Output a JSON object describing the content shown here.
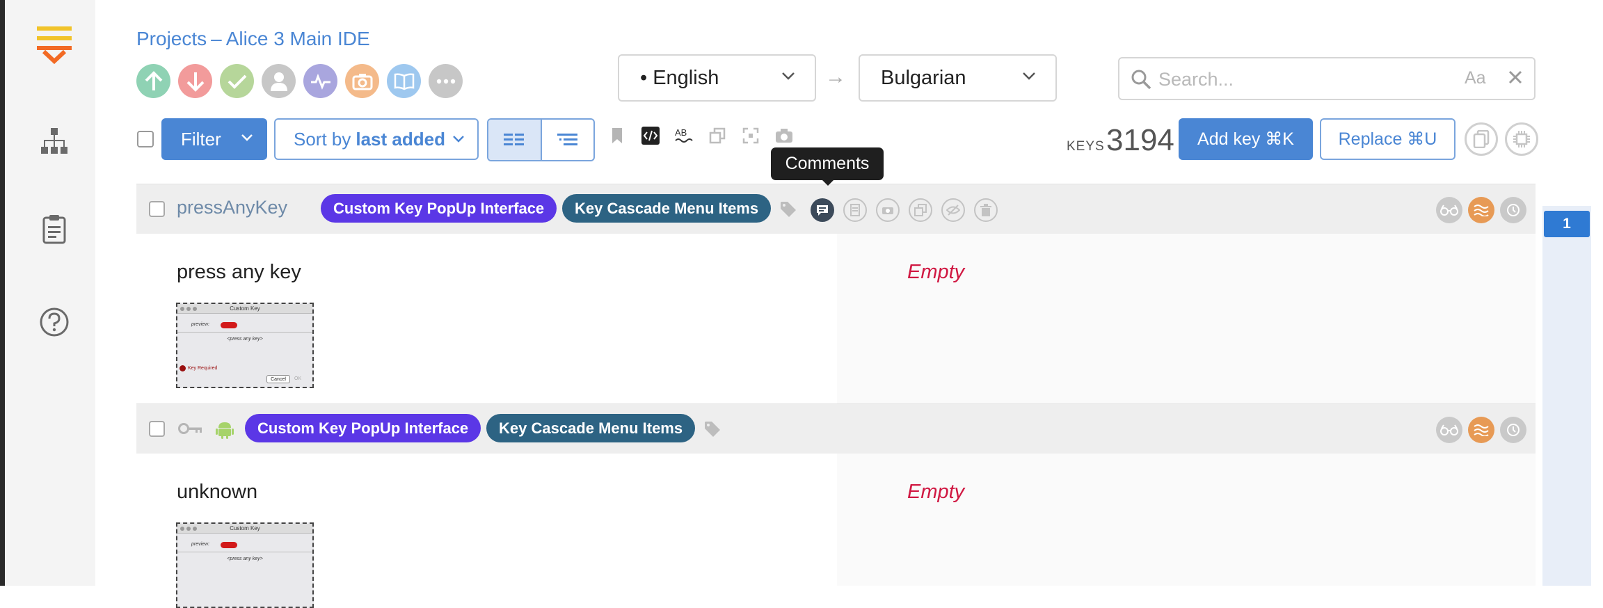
{
  "breadcrumb": {
    "root": "Projects",
    "separator": "–",
    "project": "Alice 3 Main IDE"
  },
  "colors": {
    "accent": "#4a86d4",
    "tag_purple": "#5b37e6",
    "tag_teal": "#2d6383",
    "empty_red": "#d01842",
    "tooltip_bg": "#1f1f1f"
  },
  "status_buttons": [
    {
      "icon": "upload-icon",
      "color": "#8fd2b4"
    },
    {
      "icon": "download-icon",
      "color": "#f29b9b"
    },
    {
      "icon": "check-icon",
      "color": "#b6d69a"
    },
    {
      "icon": "user-icon",
      "color": "#c7c7c7"
    },
    {
      "icon": "activity-icon",
      "color": "#a9a6de"
    },
    {
      "icon": "camera-icon",
      "color": "#f4ba8a"
    },
    {
      "icon": "book-icon",
      "color": "#9ec8ef"
    },
    {
      "icon": "more-icon",
      "color": "#c7c7c7"
    }
  ],
  "languages": {
    "source": "• English",
    "arrow": "→",
    "target": "Bulgarian"
  },
  "search": {
    "placeholder": "Search...",
    "case_toggle": "Aa"
  },
  "toolbar": {
    "filter_label": "Filter",
    "sort_prefix": "Sort by",
    "sort_value": "last added",
    "keys_label": "KEYS",
    "keys_count": "3194",
    "add_key_label": "Add key ⌘K",
    "replace_label": "Replace ⌘U"
  },
  "tooltip": {
    "text": "Comments"
  },
  "keys": [
    {
      "name": "pressAnyKey",
      "tags": [
        "Custom Key PopUp Interface",
        "Key Cascade Menu Items"
      ],
      "source": "press any key",
      "target": "Empty"
    },
    {
      "name": "",
      "tags": [
        "Custom Key PopUp Interface",
        "Key Cascade Menu Items"
      ],
      "source": "unknown",
      "target": "Empty"
    }
  ],
  "screenshot_thumb": {
    "title": "Custom Key",
    "preview_label": "preview:",
    "press_text": "<press any key>",
    "required": "Key Required",
    "cancel": "Cancel",
    "ok": "OK"
  },
  "pagination": {
    "current": "1"
  }
}
